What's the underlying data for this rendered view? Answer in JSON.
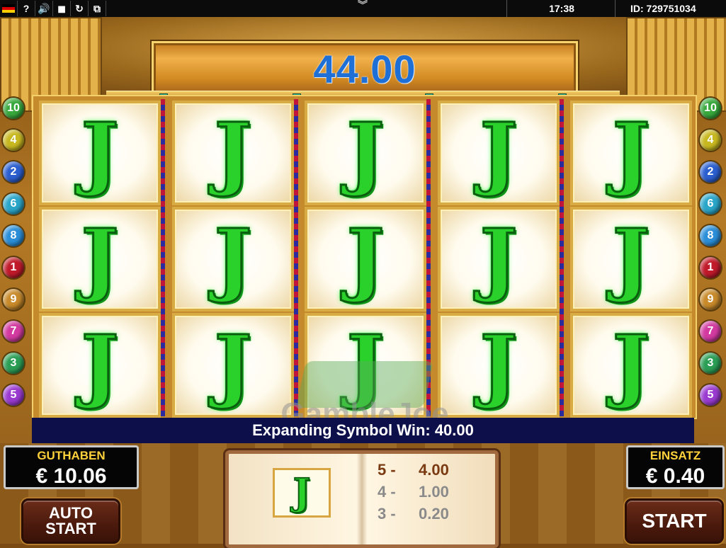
{
  "topbar": {
    "help_icon": "?",
    "clock": "17:38",
    "id_label": "ID: 729751034"
  },
  "win_amount": "44.00",
  "reels": [
    [
      "J",
      "J",
      "J",
      "J",
      "J"
    ],
    [
      "J",
      "J",
      "J",
      "J",
      "J"
    ],
    [
      "J",
      "J",
      "J",
      "J",
      "J"
    ]
  ],
  "paylines_left": [
    "10",
    "4",
    "2",
    "6",
    "8",
    "1",
    "9",
    "7",
    "3",
    "5"
  ],
  "paylines_right": [
    "10",
    "4",
    "2",
    "6",
    "8",
    "1",
    "9",
    "7",
    "3",
    "5"
  ],
  "payline_colors": {
    "10": "#37a83c",
    "4": "#c8b820",
    "2": "#2b5fd0",
    "6": "#2aa6c9",
    "8": "#2a8ed8",
    "1": "#c01a2a",
    "9": "#c88a2a",
    "7": "#d23aa0",
    "3": "#2b9e55",
    "5": "#9a3ad0"
  },
  "win_message": "Expanding Symbol Win: 40.00",
  "watermark": "GambleJoe",
  "credit": {
    "label": "GUTHABEN",
    "value": "€ 10.06"
  },
  "bet": {
    "label": "EINSATZ",
    "value": "€ 0.40"
  },
  "buttons": {
    "autostart_line1": "AUTO",
    "autostart_line2": "START",
    "start": "START"
  },
  "paytable": {
    "symbol": "J",
    "rows": [
      {
        "count": "5 -",
        "value": "4.00",
        "color": "#7a3a12"
      },
      {
        "count": "4 -",
        "value": "1.00",
        "color": "#8a8a8a"
      },
      {
        "count": "3 -",
        "value": "0.20",
        "color": "#8a8a8a"
      }
    ]
  }
}
